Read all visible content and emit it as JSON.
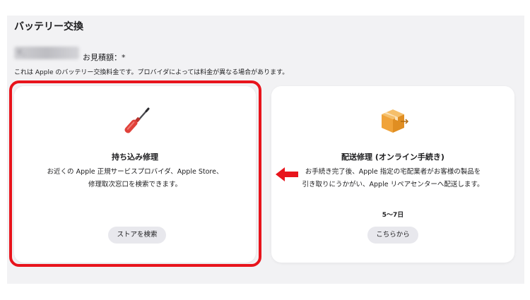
{
  "section": {
    "title": "バッテリー交換",
    "estimate_label": "お見積額：*",
    "price_hidden": "¥, ",
    "note": "これは Apple のバッテリー交換料金です。プロバイダによっては料金が異なる場合があります。"
  },
  "cards": [
    {
      "icon": "screwdriver-icon",
      "title": "持ち込み修理",
      "desc_line1": "お近くの Apple 正規サービスプロバイダ、Apple Store、",
      "desc_line2": "修理取次窓口を検索できます。",
      "button": "ストアを検索"
    },
    {
      "icon": "box-icon",
      "title": "配送修理 (オンライン手続き)",
      "desc_line1": "お手続き完了後、Apple 指定の宅配業者がお客様の製品を",
      "desc_line2": "引き取りにうかがい、Apple リペアセンターへ配送します。",
      "days": "5～7日",
      "button": "こちらから"
    }
  ],
  "colors": {
    "highlight": "#e8141c",
    "icon_red": "#e0413a",
    "icon_orange": "#f0a33a"
  }
}
